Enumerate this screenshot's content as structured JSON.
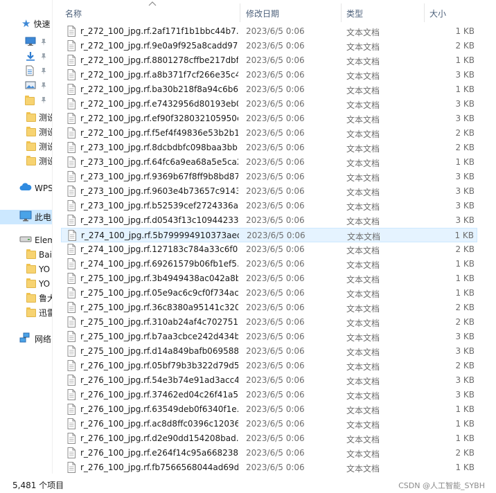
{
  "nav": {
    "items": [
      {
        "label": "快速",
        "icon": "star-icon",
        "pinned": false
      },
      {
        "label": "",
        "icon": "desktop-icon",
        "pinned": true
      },
      {
        "label": "",
        "icon": "download-icon",
        "pinned": true
      },
      {
        "label": "",
        "icon": "document-icon",
        "pinned": true
      },
      {
        "label": "",
        "icon": "picture-icon",
        "pinned": true
      },
      {
        "label": "",
        "icon": "folder-icon",
        "pinned": true
      },
      {
        "label": "测设",
        "icon": "folder-icon",
        "pinned": false
      },
      {
        "label": "测设",
        "icon": "folder-icon",
        "pinned": false
      },
      {
        "label": "测设",
        "icon": "folder-icon",
        "pinned": false
      },
      {
        "label": "测设",
        "icon": "folder-icon",
        "pinned": false
      },
      {
        "label": "WPS",
        "icon": "cloud-icon",
        "pinned": false
      },
      {
        "label": "此电",
        "icon": "pc-icon",
        "pinned": false,
        "selected": true
      },
      {
        "label": "Elem",
        "icon": "drive-icon",
        "pinned": false
      },
      {
        "label": "Bai",
        "icon": "folder-icon",
        "pinned": false
      },
      {
        "label": "YO",
        "icon": "folder-icon",
        "pinned": false
      },
      {
        "label": "YO",
        "icon": "folder-icon",
        "pinned": false
      },
      {
        "label": "鲁大",
        "icon": "folder-icon",
        "pinned": false
      },
      {
        "label": "迅雷",
        "icon": "folder-icon",
        "pinned": false
      },
      {
        "label": "网络",
        "icon": "network-icon",
        "pinned": false
      }
    ]
  },
  "header": {
    "name": "名称",
    "date": "修改日期",
    "type": "类型",
    "size": "大小"
  },
  "files": [
    {
      "name": "r_272_100_jpg.rf.2af171f1b1bbc44b7...",
      "date": "2023/6/5 0:06",
      "type": "文本文档",
      "size": "1 KB"
    },
    {
      "name": "r_272_100_jpg.rf.9e0a9f925a8cadd97...",
      "date": "2023/6/5 0:06",
      "type": "文本文档",
      "size": "2 KB"
    },
    {
      "name": "r_272_100_jpg.rf.8801278cffbe217dbf...",
      "date": "2023/6/5 0:06",
      "type": "文本文档",
      "size": "1 KB"
    },
    {
      "name": "r_272_100_jpg.rf.a8b371f7cf266e35c4...",
      "date": "2023/6/5 0:06",
      "type": "文本文档",
      "size": "3 KB"
    },
    {
      "name": "r_272_100_jpg.rf.ba30b218f8a94c6b6...",
      "date": "2023/6/5 0:06",
      "type": "文本文档",
      "size": "1 KB"
    },
    {
      "name": "r_272_100_jpg.rf.e7432956d80193eb0...",
      "date": "2023/6/5 0:06",
      "type": "文本文档",
      "size": "3 KB"
    },
    {
      "name": "r_272_100_jpg.rf.ef90f328032105950e...",
      "date": "2023/6/5 0:06",
      "type": "文本文档",
      "size": "3 KB"
    },
    {
      "name": "r_272_100_jpg.rf.f5ef4f49836e53b2b1...",
      "date": "2023/6/5 0:06",
      "type": "文本文档",
      "size": "2 KB"
    },
    {
      "name": "r_273_100_jpg.rf.8dcbdbfc098baa3bb...",
      "date": "2023/6/5 0:06",
      "type": "文本文档",
      "size": "2 KB"
    },
    {
      "name": "r_273_100_jpg.rf.64fc6a9ea68a5e5ca2...",
      "date": "2023/6/5 0:06",
      "type": "文本文档",
      "size": "1 KB"
    },
    {
      "name": "r_273_100_jpg.rf.9369b67f8ff9b8bd87...",
      "date": "2023/6/5 0:06",
      "type": "文本文档",
      "size": "3 KB"
    },
    {
      "name": "r_273_100_jpg.rf.9603e4b73657c9143...",
      "date": "2023/6/5 0:06",
      "type": "文本文档",
      "size": "3 KB"
    },
    {
      "name": "r_273_100_jpg.rf.b52539cef2724336a...",
      "date": "2023/6/5 0:06",
      "type": "文本文档",
      "size": "3 KB"
    },
    {
      "name": "r_273_100_jpg.rf.d0543f13c10944233...",
      "date": "2023/6/5 0:06",
      "type": "文本文档",
      "size": "3 KB"
    },
    {
      "name": "r_274_100_jpg.rf.5b799994910373aed...",
      "date": "2023/6/5 0:06",
      "type": "文本文档",
      "size": "1 KB",
      "selected": true
    },
    {
      "name": "r_274_100_jpg.rf.127183c784a33c6f0...",
      "date": "2023/6/5 0:06",
      "type": "文本文档",
      "size": "2 KB"
    },
    {
      "name": "r_274_100_jpg.rf.69261579b06fb1ef5...",
      "date": "2023/6/5 0:06",
      "type": "文本文档",
      "size": "1 KB"
    },
    {
      "name": "r_275_100_jpg.rf.3b4949438ac042a8b...",
      "date": "2023/6/5 0:06",
      "type": "文本文档",
      "size": "1 KB"
    },
    {
      "name": "r_275_100_jpg.rf.05e9ac6c9cf0f734ac...",
      "date": "2023/6/5 0:06",
      "type": "文本文档",
      "size": "1 KB"
    },
    {
      "name": "r_275_100_jpg.rf.36c8380a95141c320...",
      "date": "2023/6/5 0:06",
      "type": "文本文档",
      "size": "2 KB"
    },
    {
      "name": "r_275_100_jpg.rf.310ab24af4c702751...",
      "date": "2023/6/5 0:06",
      "type": "文本文档",
      "size": "2 KB"
    },
    {
      "name": "r_275_100_jpg.rf.b7aa3cbce242d434b...",
      "date": "2023/6/5 0:06",
      "type": "文本文档",
      "size": "3 KB"
    },
    {
      "name": "r_275_100_jpg.rf.d14a849bafb069588...",
      "date": "2023/6/5 0:06",
      "type": "文本文档",
      "size": "3 KB"
    },
    {
      "name": "r_276_100_jpg.rf.05bf79b3b322d79d5...",
      "date": "2023/6/5 0:06",
      "type": "文本文档",
      "size": "2 KB"
    },
    {
      "name": "r_276_100_jpg.rf.54e3b74e91ad3acc4...",
      "date": "2023/6/5 0:06",
      "type": "文本文档",
      "size": "3 KB"
    },
    {
      "name": "r_276_100_jpg.rf.37462ed04c26f41a5...",
      "date": "2023/6/5 0:06",
      "type": "文本文档",
      "size": "3 KB"
    },
    {
      "name": "r_276_100_jpg.rf.63549deb0f6340f1e...",
      "date": "2023/6/5 0:06",
      "type": "文本文档",
      "size": "1 KB"
    },
    {
      "name": "r_276_100_jpg.rf.ac8d8ffc0396c12036...",
      "date": "2023/6/5 0:06",
      "type": "文本文档",
      "size": "1 KB"
    },
    {
      "name": "r_276_100_jpg.rf.d2e90dd154208bad...",
      "date": "2023/6/5 0:06",
      "type": "文本文档",
      "size": "1 KB"
    },
    {
      "name": "r_276_100_jpg.rf.e264f14c95a668238...",
      "date": "2023/6/5 0:06",
      "type": "文本文档",
      "size": "2 KB"
    },
    {
      "name": "r_276_100_jpg.rf.fb7566568044ad69d...",
      "date": "2023/6/5 0:06",
      "type": "文本文档",
      "size": "1 KB"
    }
  ],
  "status": {
    "count": "5,481 个项目",
    "watermark": "CSDN @人工智能_SYBH"
  },
  "colors": {
    "selection_bg": "#e5f3ff",
    "selection_border": "#cce8ff",
    "nav_selected": "#cce8ff",
    "header_text": "#4c607a",
    "folder": "#f7d371"
  }
}
